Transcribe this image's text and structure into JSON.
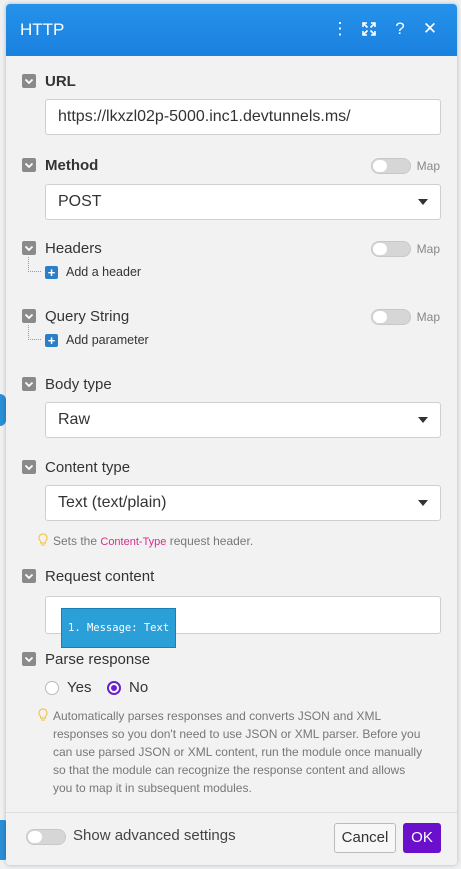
{
  "dialog": {
    "title": "HTTP"
  },
  "fields": {
    "url": {
      "label": "URL",
      "value": "https://lkxzl02p-5000.inc1.devtunnels.ms/"
    },
    "method": {
      "label": "Method",
      "value": "POST",
      "map_label": "Map"
    },
    "headers": {
      "label": "Headers",
      "map_label": "Map",
      "add_label": "Add a header"
    },
    "query_string": {
      "label": "Query String",
      "map_label": "Map",
      "add_label": "Add parameter"
    },
    "body_type": {
      "label": "Body type",
      "value": "Raw"
    },
    "content_type": {
      "label": "Content type",
      "value": "Text (text/plain)",
      "hint_before": "Sets the ",
      "hint_link": "Content-Type",
      "hint_after": " request header."
    },
    "request_content": {
      "label": "Request content",
      "pill": "1. Message: Text"
    },
    "parse_response": {
      "label": "Parse response",
      "options": [
        "Yes",
        "No"
      ],
      "selected": "No",
      "hint": "Automatically parses responses and converts JSON and XML responses so you don't need to use JSON or XML parser. Before you can use parsed JSON or XML content, run the module once manually so that the module can recognize the response content and allows you to map it in subsequent modules."
    }
  },
  "footer": {
    "advanced_label": "Show advanced settings",
    "cancel_label": "Cancel",
    "ok_label": "OK"
  },
  "colors": {
    "titlebar": "#1e88e5",
    "ok_button": "#6a0fcc",
    "radio_selected": "#6a1fd0",
    "pill": "#2a9fd8",
    "link": "#d0318a"
  }
}
